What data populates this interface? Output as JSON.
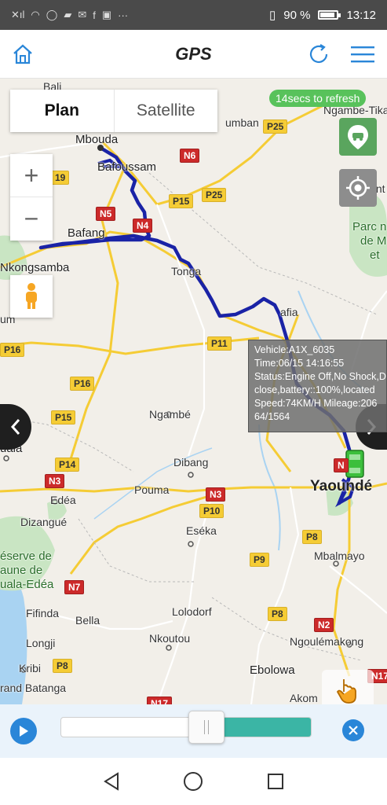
{
  "status_bar": {
    "left_icons": [
      "sim-icon",
      "wifi-icon",
      "whatsapp-icon",
      "game-icon",
      "mail-icon",
      "facebook-icon",
      "gallery-icon",
      "more-icon"
    ],
    "battery_text": "90 %",
    "battery_level": 0.9,
    "time": "13:12"
  },
  "header": {
    "title": "GPS",
    "home_icon": "home-icon",
    "refresh_icon": "refresh-icon",
    "menu_icon": "menu-icon"
  },
  "map": {
    "type_toggle": {
      "plan": "Plan",
      "satellite": "Satellite",
      "active": "plan"
    },
    "refresh_countdown": "14secs to refresh",
    "zoom_in": "+",
    "zoom_out": "−",
    "labels": {
      "bali": "Bali",
      "mbouda": "Mbouda",
      "bafoussam": "Bafoussam",
      "bafang": "Bafang",
      "nkongsamba": "Nkongsamba",
      "tonga": "Tonga",
      "bafia": "afia",
      "foumban": "umban",
      "ngambe_tikar": "Ngambe-Tikar",
      "lint": "Lint",
      "parc": "Parc n",
      "parc2": "de M",
      "parc3": "et",
      "ngambe": "Ngambé",
      "dibang": "Dibang",
      "edea": "Edéa",
      "pouma": "Pouma",
      "dizangue": "Dizangué",
      "reserve1": "éserve de",
      "reserve2": "aune de",
      "reserve3": "uala-Edéa",
      "eseka": "Eséka",
      "yaounde": "Yaoundé",
      "mbalmayo": "Mbalmayo",
      "fifinda": "Fifinda",
      "bella": "Bella",
      "lolodorf": "Lolodorf",
      "nkoutou": "Nkoutou",
      "ngoulemakong": "Ngoulémakong",
      "longji": "Longji",
      "kribi": "Kribi",
      "ebolowa": "Ebolowa",
      "grand_batanga": "rand Batanga",
      "akom": "Akom",
      "dala": "uala",
      "um": "um"
    },
    "roads": {
      "p25a": "P25",
      "n6": "N6",
      "p15a": "P15",
      "p25b": "P25",
      "n5": "N5",
      "n4": "N4",
      "r19": "19",
      "p16a": "P16",
      "p11": "P11",
      "p16b": "P16",
      "p15b": "P15",
      "p14": "P14",
      "n3a": "N3",
      "n3b": "N3",
      "p10": "P10",
      "p8a": "P8",
      "n7": "N7",
      "p9": "P9",
      "p8b": "P8",
      "n2": "N2",
      "p8c": "P8",
      "n17a": "N17",
      "n17b": "N17",
      "n1": "N"
    },
    "popup": {
      "vehicle": "Vehicle:A1X_6035",
      "time": "Time:06/15 14:16:55",
      "status": "Status:Engine Off,No Shock,D",
      "status2": "close,battery::100%,located",
      "speed": "Speed:74KM/H Mileage:206",
      "mileage2": "64/1564"
    },
    "colors": {
      "route": "#1a23a6",
      "vehicle": "#3cbf3c",
      "water": "#a9d3f2",
      "park": "#c9e5c3"
    }
  },
  "playback": {
    "play_icon": "play-icon",
    "close_icon": "close-icon",
    "progress": 0.58
  },
  "system_nav": {
    "back": "back-icon",
    "home": "home-icon",
    "recent": "recent-icon"
  }
}
